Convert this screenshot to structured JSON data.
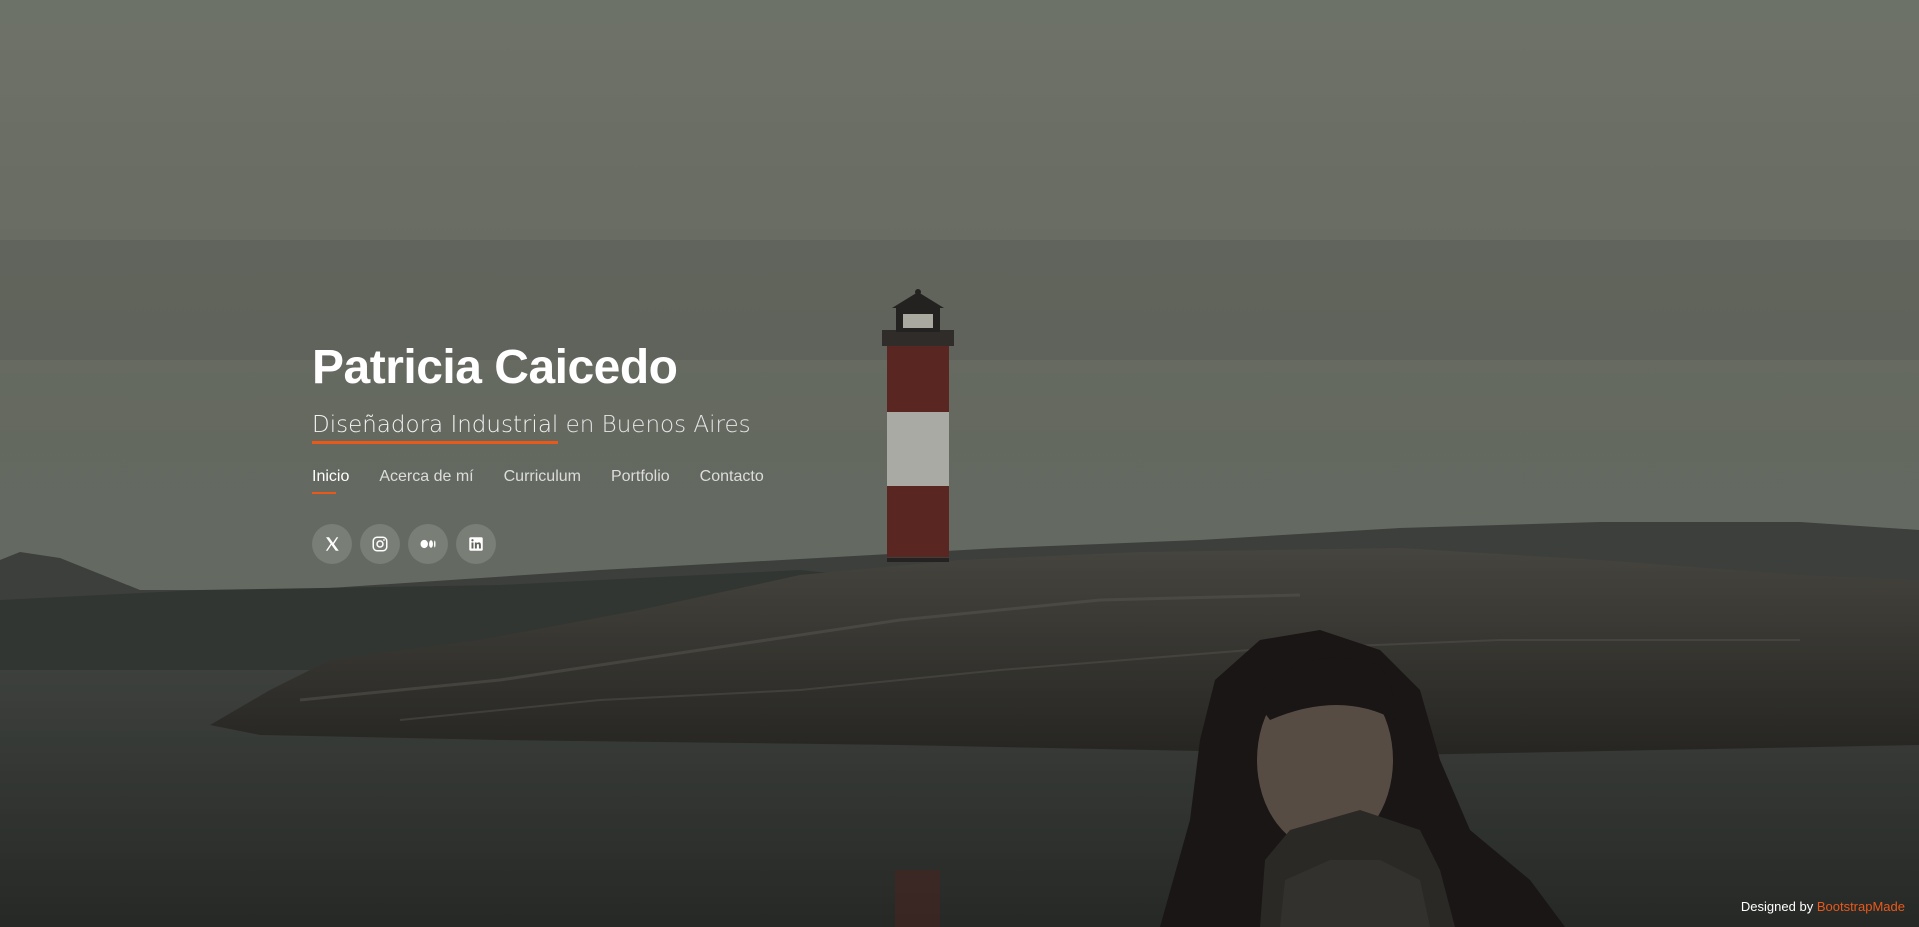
{
  "hero": {
    "name": "Patricia Caicedo",
    "subtitle_highlight": "Diseñadora Industrial",
    "subtitle_rest": "en Buenos Aires"
  },
  "nav": {
    "items": [
      {
        "label": "Inicio",
        "active": true
      },
      {
        "label": "Acerca de mí",
        "active": false
      },
      {
        "label": "Curriculum",
        "active": false
      },
      {
        "label": "Portfolio",
        "active": false
      },
      {
        "label": "Contacto",
        "active": false
      }
    ]
  },
  "social": {
    "icons": [
      "x-twitter-icon",
      "instagram-icon",
      "medium-icon",
      "linkedin-icon"
    ]
  },
  "footer": {
    "credits_prefix": "Designed by",
    "credits_link": "BootstrapMade"
  },
  "colors": {
    "accent": "#e8591a",
    "text": "#ffffff"
  }
}
